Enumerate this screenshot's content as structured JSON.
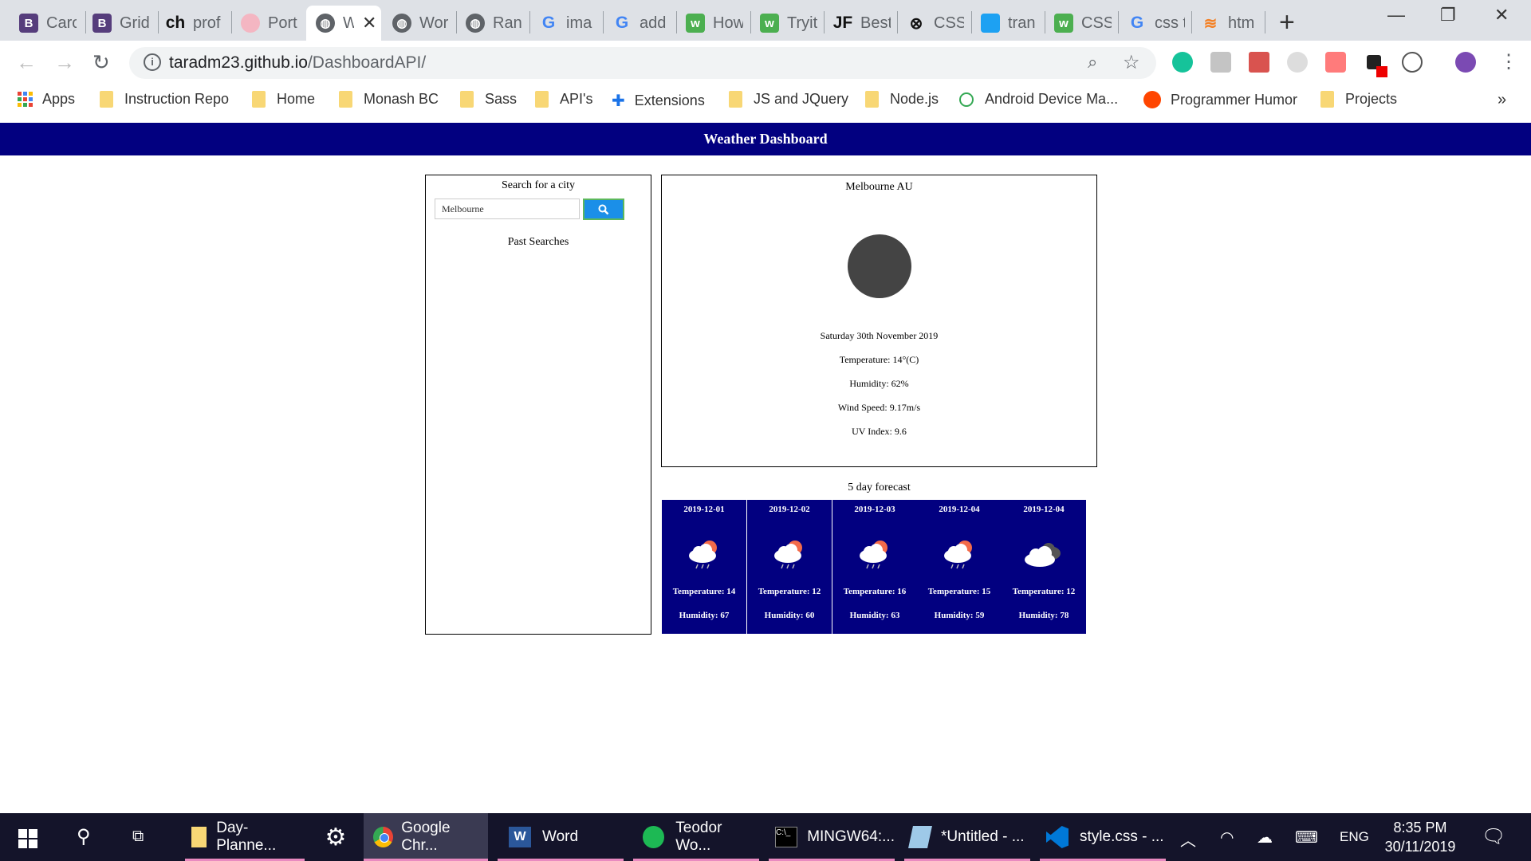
{
  "browser": {
    "tabs": [
      {
        "label": "Caro",
        "icon": "bootstrap-icon",
        "color": "#563d7c"
      },
      {
        "label": "Grid",
        "icon": "bootstrap-icon",
        "color": "#563d7c"
      },
      {
        "label": "prof",
        "icon": "ch-icon",
        "color": "#ffffff"
      },
      {
        "label": "Port",
        "icon": "pig-icon",
        "color": "#f4b6c2"
      },
      {
        "label": "W",
        "icon": "globe-icon",
        "color": "#5f6368",
        "active": true
      },
      {
        "label": "Wor",
        "icon": "globe-icon",
        "color": "#5f6368"
      },
      {
        "label": "Ran",
        "icon": "globe-icon",
        "color": "#5f6368"
      },
      {
        "label": "ima",
        "icon": "google-icon",
        "color": "#4285f4"
      },
      {
        "label": "add",
        "icon": "google-icon",
        "color": "#4285f4"
      },
      {
        "label": "How",
        "icon": "w3schools-icon",
        "color": "#4caf50"
      },
      {
        "label": "Tryit",
        "icon": "w3schools-icon",
        "color": "#4caf50"
      },
      {
        "label": "Best",
        "icon": "jf-icon",
        "color": "#ffffff"
      },
      {
        "label": "CSS",
        "icon": "codepen-icon",
        "color": "#ffffff"
      },
      {
        "label": "tran",
        "icon": "mortarboard-icon",
        "color": "#1da1f2"
      },
      {
        "label": "CSS",
        "icon": "w3schools-icon",
        "color": "#4caf50"
      },
      {
        "label": "css t",
        "icon": "google-icon",
        "color": "#4285f4"
      },
      {
        "label": "htm",
        "icon": "stackoverflow-icon",
        "color": "#f48024"
      }
    ],
    "url_host": "taradm23.github.io",
    "url_path": "/DashboardAPI/",
    "bookmarks": [
      {
        "label": "Apps",
        "type": "apps"
      },
      {
        "label": "Instruction Repo",
        "type": "folder"
      },
      {
        "label": "Home",
        "type": "folder"
      },
      {
        "label": "Monash BC",
        "type": "folder"
      },
      {
        "label": "Sass",
        "type": "folder"
      },
      {
        "label": "API's",
        "type": "folder"
      },
      {
        "label": "Extensions",
        "type": "puzzle"
      },
      {
        "label": "JS and JQuery",
        "type": "folder"
      },
      {
        "label": "Node.js",
        "type": "folder"
      },
      {
        "label": "Android Device Ma...",
        "type": "android"
      },
      {
        "label": "Programmer Humor",
        "type": "reddit"
      },
      {
        "label": "Projects",
        "type": "folder"
      }
    ]
  },
  "page": {
    "title": "Weather Dashboard",
    "search_label": "Search for a city",
    "search_value": "Melbourne",
    "past_searches_label": "Past Searches",
    "current": {
      "city": "Melbourne AU",
      "date": "Saturday 30th November 2019",
      "temperature": "Temperature: 14°(C)",
      "humidity": "Humidity: 62%",
      "wind": "Wind Speed: 9.17m/s",
      "uv": "UV Index: 9.6"
    },
    "forecast_title": "5 day forecast",
    "forecast": [
      {
        "date": "2019-12-01",
        "temp": "Temperature: 14",
        "hum": "Humidity: 67",
        "icon": "sun-rain-cloud-icon"
      },
      {
        "date": "2019-12-02",
        "temp": "Temperature: 12",
        "hum": "Humidity: 60",
        "icon": "sun-rain-cloud-icon"
      },
      {
        "date": "2019-12-03",
        "temp": "Temperature: 16",
        "hum": "Humidity: 63",
        "icon": "sun-rain-cloud-icon"
      },
      {
        "date": "2019-12-04",
        "temp": "Temperature: 15",
        "hum": "Humidity: 59",
        "icon": "sun-rain-cloud-icon"
      },
      {
        "date": "2019-12-04",
        "temp": "Temperature: 12",
        "hum": "Humidity: 78",
        "icon": "cloud-icon"
      }
    ]
  },
  "taskbar": {
    "items": [
      {
        "label": "Day-Planne...",
        "icon": "folder-icon"
      },
      {
        "label": "",
        "icon": "settings-icon"
      },
      {
        "label": "Google Chr...",
        "icon": "chrome-icon"
      },
      {
        "label": "Word",
        "icon": "word-icon"
      },
      {
        "label": "Teodor Wo...",
        "icon": "spotify-icon"
      },
      {
        "label": "MINGW64:...",
        "icon": "terminal-icon"
      },
      {
        "label": "*Untitled - ...",
        "icon": "notepad-icon"
      },
      {
        "label": "style.css - ...",
        "icon": "vscode-icon"
      }
    ],
    "language": "ENG",
    "time": "8:35 PM",
    "date": "30/11/2019"
  }
}
